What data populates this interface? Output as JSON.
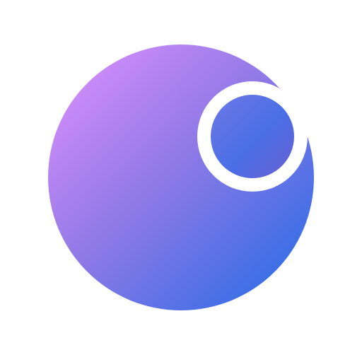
{
  "logo": {
    "icon_name": "orb-logo-icon",
    "colors": {
      "background": "#ffffff",
      "gradient_start": "#c78af7",
      "gradient_mid": "#8f79e6",
      "gradient_end": "#3f6fe6",
      "ring": "#ffffff",
      "inner_start": "#6f78e6",
      "inner_mid": "#4a6fe6",
      "inner_end": "#6a5fd2"
    }
  }
}
